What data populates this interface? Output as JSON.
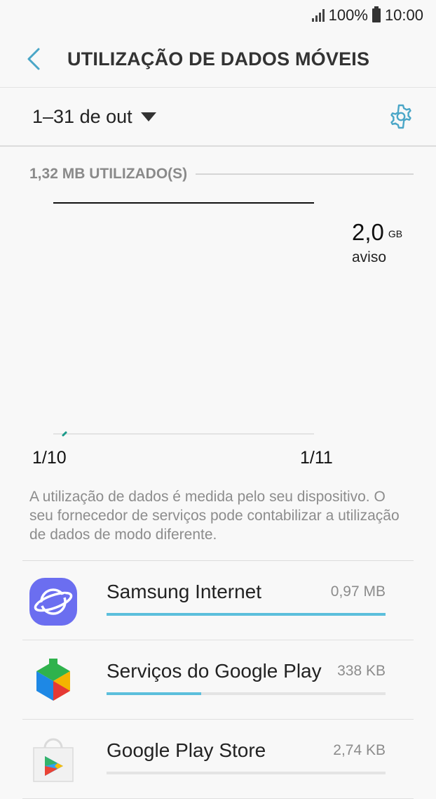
{
  "status_bar": {
    "battery": "100%",
    "time": "10:00"
  },
  "header": {
    "title": "UTILIZAÇÃO DE DADOS MÓVEIS"
  },
  "period": {
    "label": "1–31 de out"
  },
  "usage": {
    "used_label": "1,32 MB UTILIZADO(S)"
  },
  "chart": {
    "warning_value": "2,0",
    "warning_unit": "GB",
    "warning_label": "aviso",
    "x_start": "1/10",
    "x_end": "1/11"
  },
  "note": "A utilização de dados é medida pelo seu dispositivo. O seu fornecedor de serviços pode contabilizar a utilização de dados de modo diferente.",
  "apps": [
    {
      "name": "Samsung Internet",
      "size": "0,97 MB",
      "fraction": 1.0,
      "icon": "samsung-internet-icon"
    },
    {
      "name": "Serviços do Google Play",
      "size": "338 KB",
      "fraction": 0.34,
      "icon": "google-play-services-icon"
    },
    {
      "name": "Google Play Store",
      "size": "2,74 KB",
      "fraction": 0.0,
      "icon": "google-play-store-icon"
    }
  ],
  "colors": {
    "accent": "#5cbfdc",
    "chart_line": "#1a9a8a",
    "samsung_internet": "#6b6ef0"
  }
}
